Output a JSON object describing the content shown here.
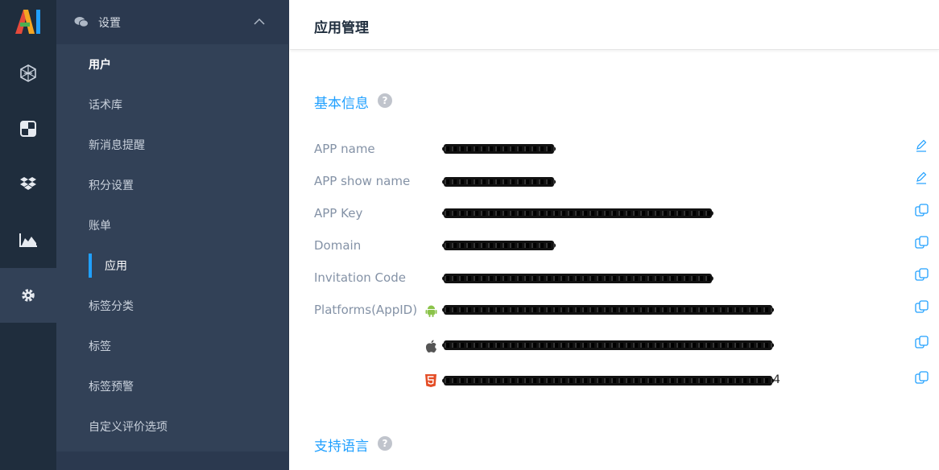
{
  "rail": {
    "logo_text": "AI",
    "items": [
      {
        "icon": "hexagon-network-icon"
      },
      {
        "icon": "checker-square-icon"
      },
      {
        "icon": "dropbox-icon"
      },
      {
        "icon": "area-chart-icon"
      },
      {
        "icon": "gear-icon",
        "active": true
      }
    ]
  },
  "sidebar": {
    "header": {
      "label": "设置",
      "icon": "chat-bubbles-icon",
      "toggle_icon": "chevron-up-icon"
    },
    "items": [
      {
        "label": "用户"
      },
      {
        "label": "话术库"
      },
      {
        "label": "新消息提醒"
      },
      {
        "label": "积分设置"
      },
      {
        "label": "账单"
      },
      {
        "label": "应用",
        "active": true
      },
      {
        "label": "标签分类"
      },
      {
        "label": "标签"
      },
      {
        "label": "标签预警"
      },
      {
        "label": "自定义评价选项"
      }
    ]
  },
  "header": {
    "title": "应用管理"
  },
  "basic_info": {
    "title": "基本信息",
    "help_icon": "question-circle-icon",
    "fields": [
      {
        "label": "APP name",
        "value": "(redacted)",
        "action_icon": "edit-pencil-icon"
      },
      {
        "label": "APP show name",
        "value": "(redacted)",
        "action_icon": "edit-pencil-icon"
      },
      {
        "label": "APP Key",
        "value": "(redacted)",
        "action_icon": "copy-icon"
      },
      {
        "label": "Domain",
        "value": "(redacted)",
        "action_icon": "copy-icon"
      },
      {
        "label": "Invitation Code",
        "value": "(redacted)",
        "action_icon": "copy-icon"
      }
    ],
    "platforms": {
      "label": "Platforms(AppID)",
      "items": [
        {
          "icon": "android-icon",
          "value": "(redacted)",
          "action_icon": "copy-icon"
        },
        {
          "icon": "apple-icon",
          "value": "(redacted)",
          "action_icon": "copy-icon"
        },
        {
          "icon": "html5-icon",
          "value": "(redacted)",
          "tail": "4",
          "action_icon": "copy-icon"
        }
      ]
    }
  },
  "languages": {
    "title": "支持语言",
    "help_icon": "question-circle-icon"
  },
  "colors": {
    "accent": "#20a0ff",
    "rail_bg": "#1f2d3d",
    "sidebar_bg": "#324157",
    "android": "#8bc34a",
    "html5": "#e44d26"
  }
}
